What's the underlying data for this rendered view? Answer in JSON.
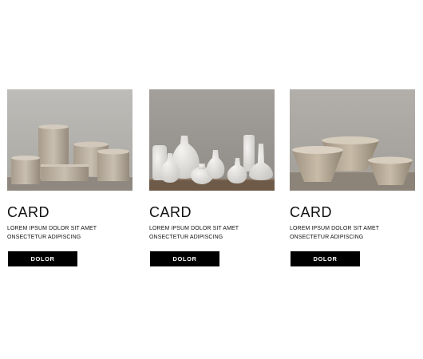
{
  "cards": [
    {
      "title": "CARD",
      "text_line1": "LOREM IPSUM DOLOR SIT AMET",
      "text_line2": "ONSECTETUR ADIPISCING",
      "button_label": "DOLOR",
      "image": "stone-vessels-photo"
    },
    {
      "title": "CARD",
      "text_line1": "LOREM IPSUM DOLOR SIT AMET",
      "text_line2": "ONSECTETUR ADIPISCING",
      "button_label": "DOLOR",
      "image": "white-vases-photo"
    },
    {
      "title": "CARD",
      "text_line1": "LOREM IPSUM DOLOR SIT AMET",
      "text_line2": "ONSECTETUR ADIPISCING",
      "button_label": "DOLOR",
      "image": "stone-bowls-photo"
    }
  ],
  "colors": {
    "button_bg": "#000000",
    "button_text": "#ffffff",
    "page_bg": "#ffffff"
  }
}
